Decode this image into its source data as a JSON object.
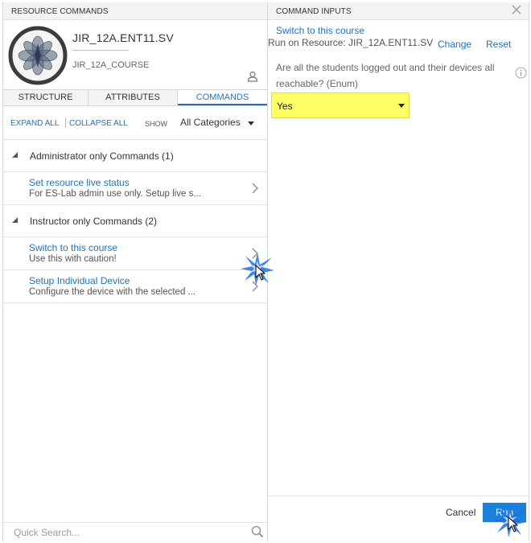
{
  "resource_commands": {
    "header": "RESOURCE COMMANDS",
    "resource_name": "JIR_12A.ENT11.SV",
    "course": "JIR_12A_COURSE",
    "tabs": [
      "STRUCTURE",
      "ATTRIBUTES",
      "COMMANDS"
    ],
    "active_tab": "COMMANDS",
    "filter": {
      "expand_all": "EXPAND ALL",
      "collapse_all": "COLLAPSE ALL",
      "show_label": "SHOW",
      "category": "All Categories"
    },
    "groups": [
      {
        "label": "Administrator only Commands (1)",
        "commands": [
          {
            "title": "Set resource live status",
            "description": "For ES-Lab admin use only. Setup live s..."
          }
        ]
      },
      {
        "label": "Instructor only Commands (2)",
        "commands": [
          {
            "title": "Switch to this course",
            "description": "Use this with caution!"
          },
          {
            "title": "Setup Individual Device",
            "description": "Configure the device with the selected ..."
          }
        ]
      }
    ],
    "quick_search_placeholder": "Quick Search..."
  },
  "command_inputs": {
    "header": "COMMAND INPUTS",
    "command": "Switch to this course",
    "run_on": "Run on Resource: JIR_12A.ENT11.SV",
    "change": "Change",
    "reset": "Reset",
    "question": "Are all the students logged out and their devices all reachable? (Enum)",
    "selected_value": "Yes",
    "cancel": "Cancel",
    "run": "Run"
  },
  "colors": {
    "accent": "#1e73be",
    "run_button": "#1a80d9",
    "highlight": "#ffff66"
  }
}
